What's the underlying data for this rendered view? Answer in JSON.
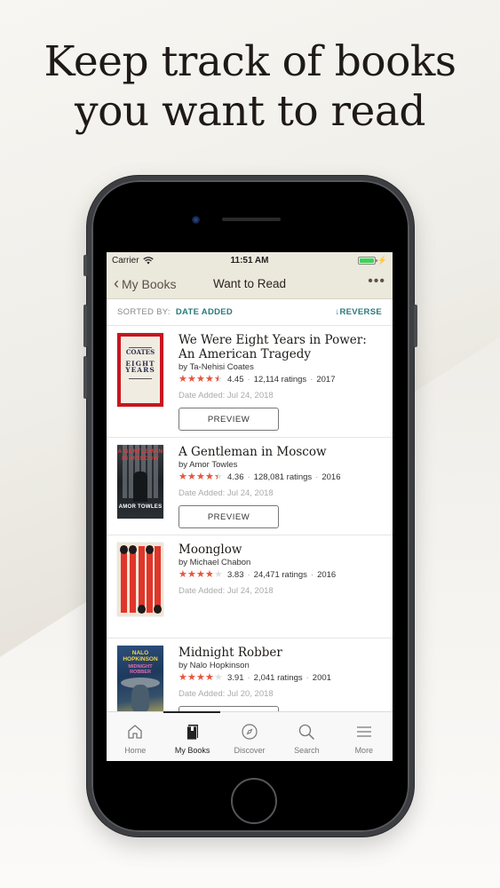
{
  "headline": {
    "line1": "Keep track of books",
    "line2": "you want to read"
  },
  "status_bar": {
    "carrier": "Carrier",
    "time": "11:51 AM",
    "battery_level": 1.0,
    "charging": true
  },
  "nav": {
    "back_label": "My Books",
    "title": "Want to Read",
    "more_icon": "ellipsis-icon"
  },
  "sort": {
    "label": "SORTED BY:",
    "value": "DATE ADDED",
    "reverse_label": "↓REVERSE"
  },
  "books": [
    {
      "title": "We Were Eight Years in Power: An American Tragedy",
      "author": "by Ta-Nehisi Coates",
      "rating": 4.45,
      "rating_text": "4.45",
      "ratings_count": "12,114 ratings",
      "year": "2017",
      "date_added": "Date Added: Jul 24, 2018",
      "preview_label": "PREVIEW",
      "cover": {
        "t1": "COATES",
        "t2": "EIGHT YEARS"
      }
    },
    {
      "title": "A Gentleman in Moscow",
      "author": "by Amor Towles",
      "rating": 4.36,
      "rating_text": "4.36",
      "ratings_count": "128,081 ratings",
      "year": "2016",
      "date_added": "Date Added: Jul 24, 2018",
      "preview_label": "PREVIEW",
      "cover": {
        "t1": "A GENTLEMAN IN MOSCOW",
        "t2": "AMOR TOWLES"
      }
    },
    {
      "title": "Moonglow",
      "author": "by Michael Chabon",
      "rating": 3.83,
      "rating_text": "3.83",
      "ratings_count": "24,471 ratings",
      "year": "2016",
      "date_added": "Date Added: Jul 24, 2018"
    },
    {
      "title": "Midnight Robber",
      "author": "by Nalo Hopkinson",
      "rating": 3.91,
      "rating_text": "3.91",
      "ratings_count": "2,041 ratings",
      "year": "2001",
      "date_added": "Date Added: Jul 20, 2018",
      "cover": {
        "t1": "NALO HOPKINSON",
        "t2": "MIDNIGHT ROBBER"
      }
    }
  ],
  "separator": "·",
  "tabs": [
    {
      "label": "Home",
      "icon": "home-icon",
      "active": false
    },
    {
      "label": "My Books",
      "icon": "book-icon",
      "active": true
    },
    {
      "label": "Discover",
      "icon": "compass-icon",
      "active": false
    },
    {
      "label": "Search",
      "icon": "search-icon",
      "active": false
    },
    {
      "label": "More",
      "icon": "menu-icon",
      "active": false
    }
  ],
  "colors": {
    "accent": "#2a7a78",
    "star": "#e8553e",
    "nav_bg": "#ebe8dc",
    "battery": "#3fd25a"
  }
}
